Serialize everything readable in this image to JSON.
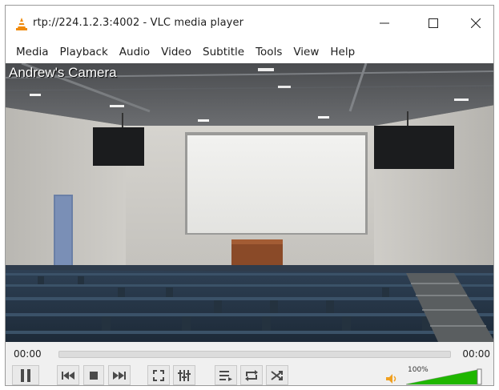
{
  "window": {
    "title": "rtp://224.1.2.3:4002 - VLC media player"
  },
  "menu": [
    "Media",
    "Playback",
    "Audio",
    "Video",
    "Subtitle",
    "Tools",
    "View",
    "Help"
  ],
  "video": {
    "overlay_text": "Andrew's Camera"
  },
  "controls": {
    "elapsed": "00:00",
    "total": "00:00",
    "seek_progress": 0,
    "volume_label": "100%",
    "volume_level": 1.0
  },
  "colors": {
    "accent_orange": "#f08a0b",
    "volume_green": "#1fb600"
  },
  "icons": [
    "vlc-cone-icon",
    "pause-icon",
    "previous-icon",
    "stop-icon",
    "next-icon",
    "fullscreen-icon",
    "extended-settings-icon",
    "playlist-icon",
    "loop-icon",
    "random-icon",
    "speaker-icon"
  ]
}
